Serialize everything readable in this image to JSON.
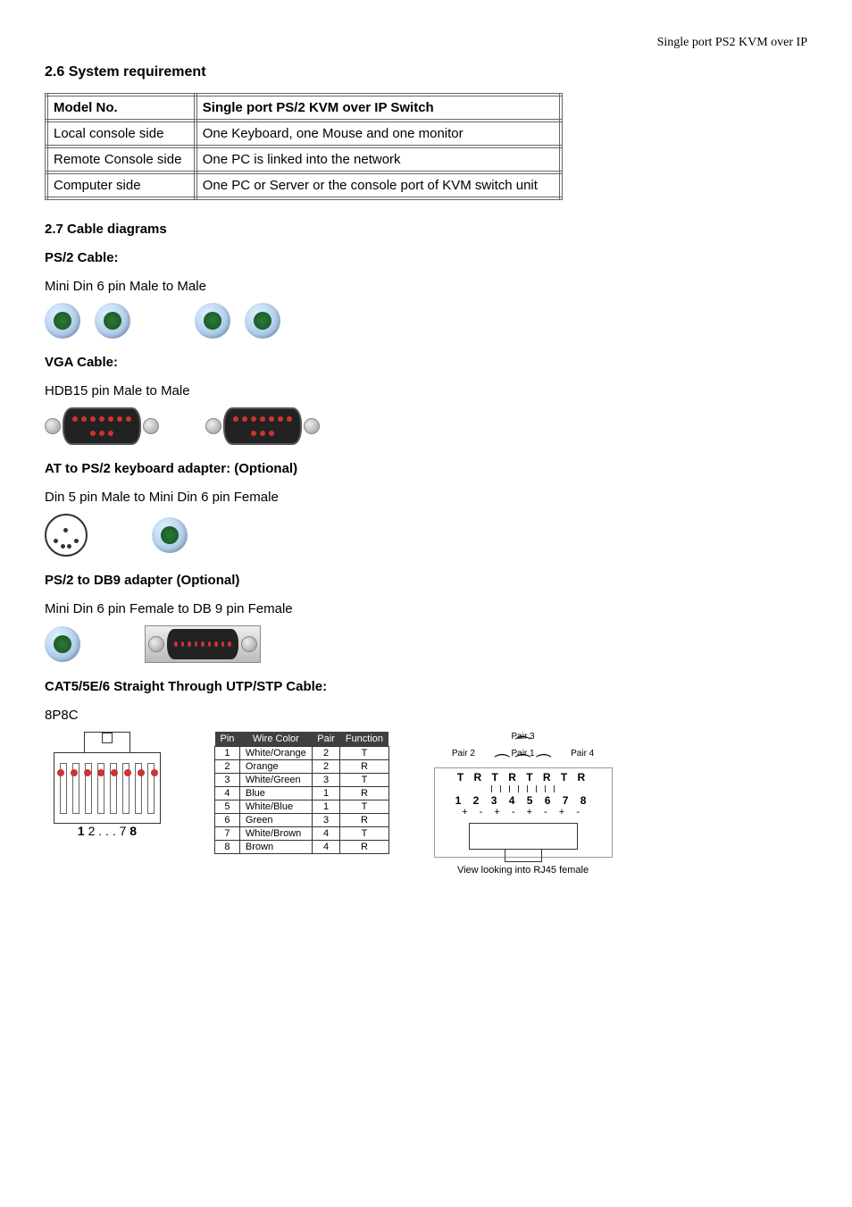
{
  "header": {
    "product": "Single port PS2 KVM over IP"
  },
  "section26": {
    "heading": "2.6 System requirement",
    "table": {
      "head": {
        "c1": "Model No.",
        "c2": "Single port PS/2 KVM over IP Switch"
      },
      "rows": [
        {
          "c1": "Local console side",
          "c2": "One Keyboard, one Mouse and one monitor"
        },
        {
          "c1": "Remote Console side",
          "c2": "One PC is linked into the network"
        },
        {
          "c1": "Computer side",
          "c2": "One PC or Server or the console port of KVM switch unit"
        }
      ]
    }
  },
  "section27": {
    "heading": "2.7 Cable diagrams",
    "ps2": {
      "title": "PS/2 Cable:",
      "desc": "Mini Din 6 pin Male to Male"
    },
    "vga": {
      "title": "VGA Cable:",
      "desc": "HDB15 pin Male to Male"
    },
    "atps2": {
      "title": "AT to PS/2 keyboard adapter: (Optional)",
      "desc": "Din 5 pin Male to Mini Din 6 pin Female"
    },
    "ps2db9": {
      "title": "PS/2 to DB9 adapter (Optional)",
      "desc": "Mini Din 6 pin Female to DB 9 pin Female"
    },
    "cat5": {
      "title": "CAT5/5E/6 Straight Through UTP/STP Cable:",
      "desc": "8P8C"
    }
  },
  "rj45": {
    "label_prefix": "1",
    "label_mid": " 2 . . . 7 ",
    "label_suffix": "8"
  },
  "wiretable": {
    "head": {
      "pin": "Pin",
      "color": "Wire Color",
      "pair": "Pair",
      "func": "Function"
    },
    "rows": [
      {
        "pin": "1",
        "color": "White/Orange",
        "pair": "2",
        "func": "T"
      },
      {
        "pin": "2",
        "color": "Orange",
        "pair": "2",
        "func": "R"
      },
      {
        "pin": "3",
        "color": "White/Green",
        "pair": "3",
        "func": "T"
      },
      {
        "pin": "4",
        "color": "Blue",
        "pair": "1",
        "func": "R"
      },
      {
        "pin": "5",
        "color": "White/Blue",
        "pair": "1",
        "func": "T"
      },
      {
        "pin": "6",
        "color": "Green",
        "pair": "3",
        "func": "R"
      },
      {
        "pin": "7",
        "color": "White/Brown",
        "pair": "4",
        "func": "T"
      },
      {
        "pin": "8",
        "color": "Brown",
        "pair": "4",
        "func": "R"
      }
    ]
  },
  "pairdiagram": {
    "top": "Pair 3",
    "labels": {
      "p2": "Pair 2",
      "p1": "Pair 1",
      "p4": "Pair 4"
    },
    "tr_row": "T R T R T R T R",
    "num_row": "1 2 3 4 5 6 7 8",
    "sign_row": "+ - + - + - + -",
    "caption": "View looking into RJ45 female"
  }
}
